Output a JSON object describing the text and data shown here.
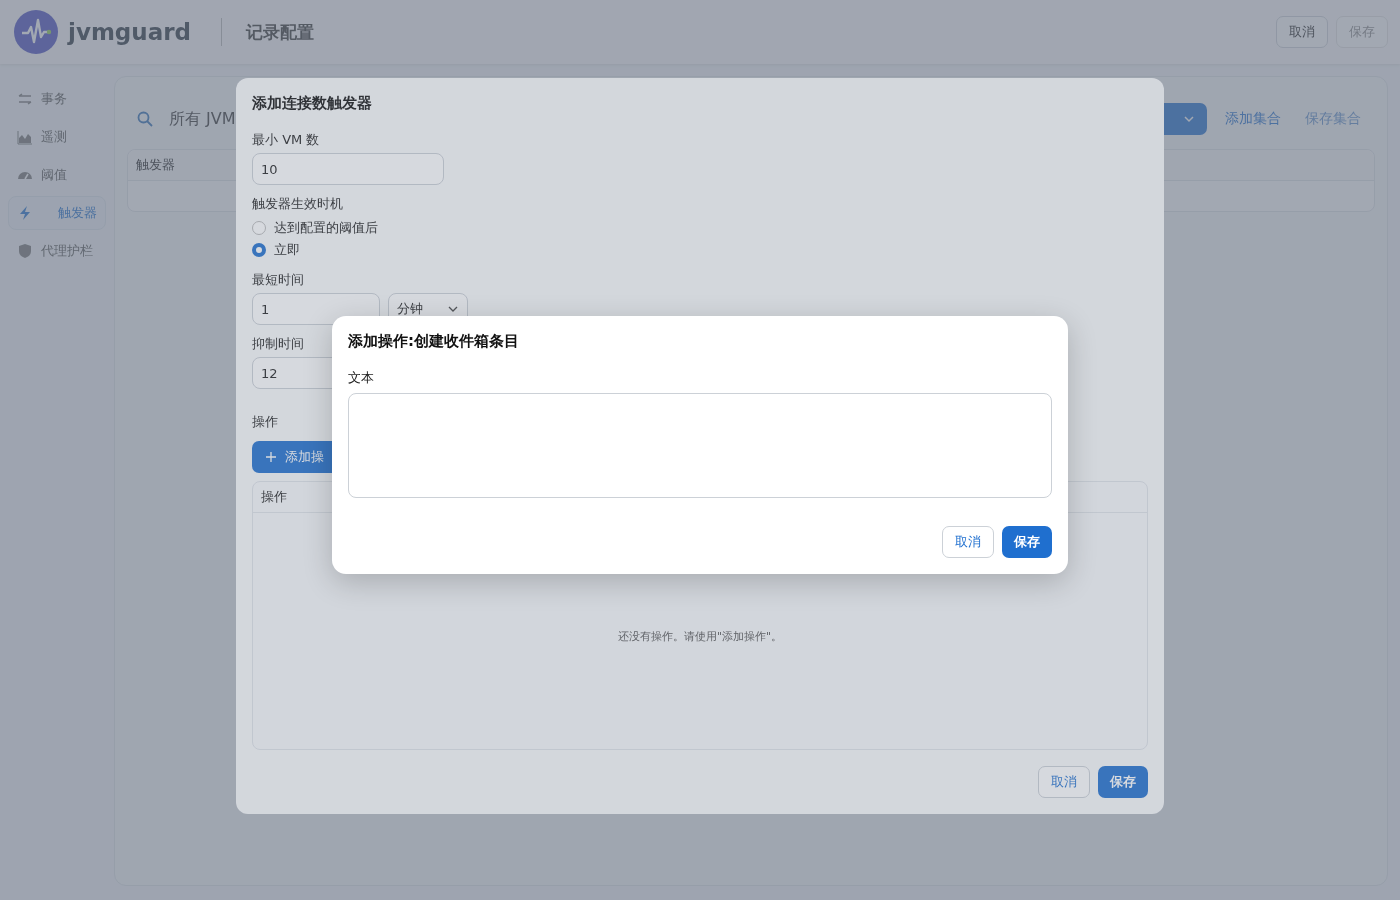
{
  "header": {
    "app_name": "jvmguard",
    "page_title": "记录配置",
    "buttons": [
      {
        "label": "取消",
        "disabled": false
      },
      {
        "label": "保存",
        "disabled": true
      }
    ]
  },
  "sidebar": {
    "items": [
      {
        "label": "事务",
        "selected": false
      },
      {
        "label": "遥测",
        "selected": false
      },
      {
        "label": "阈值",
        "selected": false
      },
      {
        "label": "触发器",
        "selected": true
      },
      {
        "label": "代理护栏",
        "selected": false
      }
    ]
  },
  "main": {
    "search_label": "所有 JVM",
    "links": [
      {
        "label": "添加集合",
        "disabled": false
      },
      {
        "label": "保存集合",
        "disabled": true
      }
    ],
    "table": {
      "columns": [
        "触发器"
      ]
    }
  },
  "dialog": {
    "title": "添加连接数触发器",
    "min_vm": {
      "label": "最小 VM 数",
      "value": "10"
    },
    "timing": {
      "label": "触发器生效时机",
      "options": [
        {
          "label": "达到配置的阈值后",
          "selected": false
        },
        {
          "label": "立即",
          "selected": true
        }
      ]
    },
    "min_time": {
      "label": "最短时间",
      "value": "1",
      "unit": "分钟"
    },
    "suppress": {
      "label": "抑制时间",
      "value": "12"
    },
    "actions": {
      "label": "操作",
      "add_button": "添加操",
      "column": "操作",
      "empty": "还没有操作。请使用\"添加操作\"。"
    },
    "buttons": [
      "取消",
      "保存"
    ]
  },
  "inner_dialog": {
    "title": "添加操作:创建收件箱条目",
    "field_label": "文本",
    "buttons": [
      "取消",
      "保存"
    ]
  }
}
